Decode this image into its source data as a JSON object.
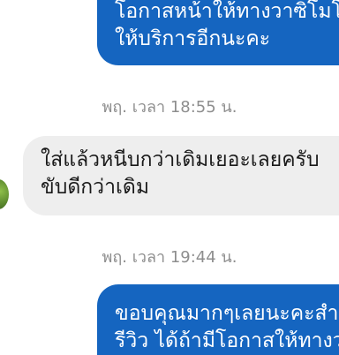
{
  "messages": {
    "top": {
      "lines": [
        "โอกาสหน้าให้ทางวาซิโมโต",
        "ให้บริการอีกนะคะ"
      ]
    },
    "timestamp_1": "พฤ. เวลา 18:55 น.",
    "mid": {
      "lines": [
        "ใส่แล้วหนีบกว่าเดิมเยอะเลยครับ",
        "ขับดีกว่าเดิม"
      ]
    },
    "timestamp_2": "พฤ. เวลา 19:44 น.",
    "bottom": {
      "lines": [
        "ขอบคุณมากๆเลยนะคะสำหรับ",
        "รีวิว ได้ถ้ามีโอกาสให้ทางวาซิ"
      ]
    }
  },
  "colors": {
    "outgoing_bubble": "#1565c0",
    "incoming_bubble": "#eeeeee",
    "timestamp_text": "#8e8e8e"
  },
  "icons": {
    "avatar": "sender-avatar"
  }
}
